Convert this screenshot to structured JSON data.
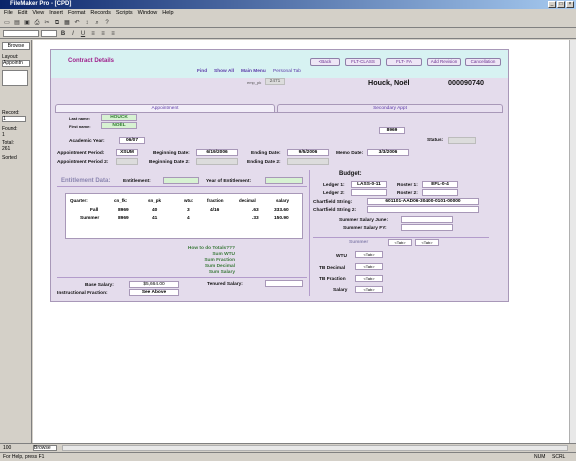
{
  "window": {
    "title": "FileMaker Pro - [CPD]"
  },
  "menu": [
    "File",
    "Edit",
    "View",
    "Insert",
    "Format",
    "Records",
    "Scripts",
    "Window",
    "Help"
  ],
  "sidebar": {
    "mode": "Browse",
    "layout_label": "Layout:",
    "layout_value": "Appointn",
    "record_label": "Record:",
    "record_value": "1",
    "found_label": "Found:",
    "found_value": "1",
    "total_label": "Total:",
    "total_value": "261",
    "sort_label": "Sorted"
  },
  "bottombar": {
    "zoom": "100",
    "mode": "Browse"
  },
  "status": {
    "left": "For Help, press F1",
    "num": "NUM",
    "scrl": "SCRL"
  },
  "header": {
    "title": "Contract Details",
    "buttons": [
      "<Back",
      "FLT-CLASS",
      "FLT- FA",
      "Add Revision",
      "Cancellation"
    ],
    "links": [
      "Find",
      "Show All",
      "Main Menu",
      "Personal Tab"
    ],
    "empl_label": "emp_pk",
    "empl_value": "2471"
  },
  "person": {
    "name": "Houck, Noël",
    "id": "000090740"
  },
  "tabs": [
    "Appointment",
    "Secondary Appt"
  ],
  "appointment": {
    "last_label": "Last name:",
    "last": "HOUCK",
    "first_label": "First name:",
    "first": "NOËL",
    "code": "8969",
    "academic_year_label": "Academic Year:",
    "academic_year": "06/07",
    "status_label": "Status:",
    "period_label": "Appointment Period:",
    "period": "XSUM",
    "begin_label": "Beginning Date:",
    "begin": "6/19/2006",
    "end_label": "Ending Date:",
    "end": "9/5/2006",
    "memo_label": "Memo Date:",
    "memo": "3/3/2006",
    "period2_label": "Appointment Period 2:",
    "begin2_label": "Beginning Date 2:",
    "end2_label": "Ending Date 2:"
  },
  "entitlement": {
    "section_label": "Entitlement Data:",
    "ent_label": "Entitlement:",
    "year_label": "Year of Entitlement:"
  },
  "budget": {
    "title": "Budget:",
    "ledger1_label": "Ledger 1:",
    "ledger1": "LASS-0-11",
    "roster1_label": "Roster 1:",
    "roster1": "EFL-0-4",
    "ledger2_label": "Ledger 2:",
    "roster2_label": "Roster 2:",
    "cfs_label": "Chartfield String:",
    "cfs": "601101-AAD06-30400-0101-00000",
    "cfs2_label": "Chartfield String 2:",
    "ssj_label": "Summer Salary June:",
    "ssfy_label": "Summer Salary FY:"
  },
  "quarter_table": {
    "headers": [
      "Quarter:",
      "cn_fk:",
      "sn_pk",
      "wtu:",
      "fraction",
      "decimal",
      "salary"
    ],
    "rows": [
      [
        "Fall",
        "8969",
        "40",
        "3",
        "4/16",
        ".63",
        "333.60"
      ],
      [
        "Summer",
        "8969",
        "41",
        "4",
        "",
        ".33",
        "150.90"
      ]
    ]
  },
  "hints": [
    "How to do Totals???",
    "Sum WTU",
    "Sum Fraction",
    "Sum Decimal",
    "Sum Salary"
  ],
  "summer": {
    "title": "Summer",
    "tab1": "<Tab>",
    "tab2": "<Tab>",
    "rows": [
      {
        "label": "WTU",
        "value": "<Tab>"
      },
      {
        "label": "TB Decimal",
        "value": "<Tab>"
      },
      {
        "label": "TB Fraction",
        "value": "<Tab>"
      },
      {
        "label": "Salary",
        "value": "<Tab>"
      }
    ]
  },
  "salary": {
    "base_label": "Base Salary:",
    "base": "$5,664.00",
    "instr_label": "Instructional Fraction:",
    "instr": "See Above",
    "tenured_label": "Tenured Salary:"
  },
  "colors": {
    "header_bg": "#d7f2f2",
    "layout_bg": "#e4dcec",
    "title": "#a0228c"
  }
}
